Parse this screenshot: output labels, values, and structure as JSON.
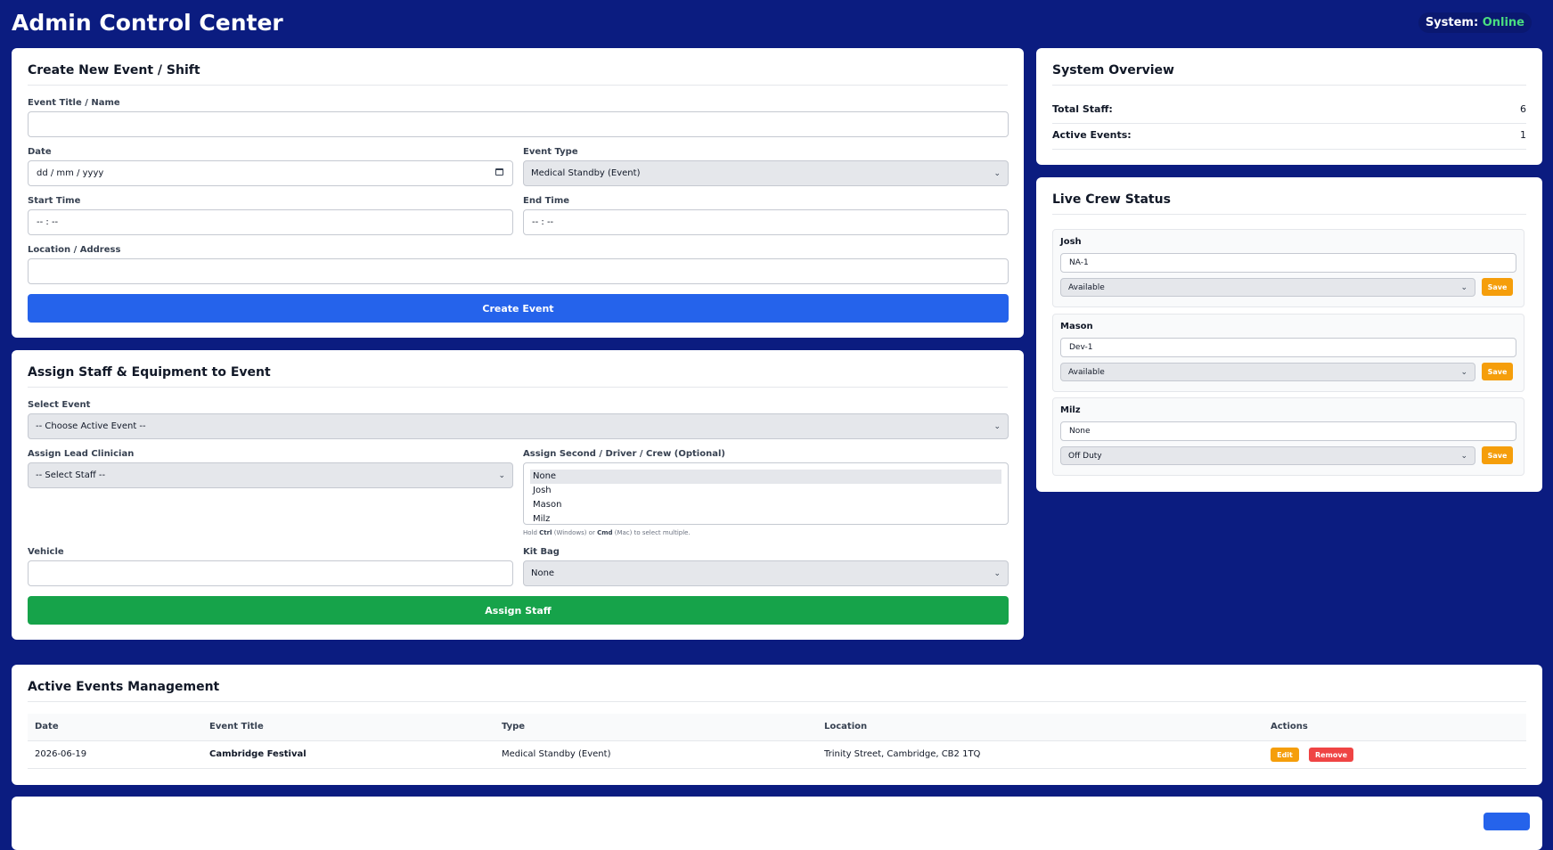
{
  "header": {
    "title": "Admin Control Center",
    "system_label": "System:",
    "system_status": "Online"
  },
  "create_event": {
    "title": "Create New Event / Shift",
    "event_title_label": "Event Title / Name",
    "date_label": "Date",
    "date_placeholder": "dd / mm / yyyy",
    "event_type_label": "Event Type",
    "event_type_value": "Medical Standby (Event)",
    "start_time_label": "Start Time",
    "start_time_placeholder": "-- : --",
    "end_time_label": "End Time",
    "end_time_placeholder": "-- : --",
    "location_label": "Location / Address",
    "submit_label": "Create Event"
  },
  "assign": {
    "title": "Assign Staff & Equipment to Event",
    "select_event_label": "Select Event",
    "select_event_value": "-- Choose Active Event --",
    "lead_label": "Assign Lead Clinician",
    "lead_value": "-- Select Staff --",
    "second_label": "Assign Second / Driver / Crew (Optional)",
    "second_options": [
      "None",
      "Josh",
      "Mason",
      "Milz"
    ],
    "hint_prefix": "Hold ",
    "hint_key1": "Ctrl",
    "hint_mid": " (Windows) or ",
    "hint_key2": "Cmd",
    "hint_suffix": " (Mac) to select multiple.",
    "vehicle_label": "Vehicle",
    "kit_label": "Kit Bag",
    "kit_value": "None",
    "submit_label": "Assign Staff"
  },
  "overview": {
    "title": "System Overview",
    "rows": [
      {
        "label": "Total Staff:",
        "value": "6"
      },
      {
        "label": "Active Events:",
        "value": "1"
      }
    ]
  },
  "crew_status": {
    "title": "Live Crew Status",
    "save_label": "Save",
    "members": [
      {
        "name": "Josh",
        "unit": "NA-1",
        "status": "Available"
      },
      {
        "name": "Mason",
        "unit": "Dev-1",
        "status": "Available"
      },
      {
        "name": "Milz",
        "unit": "None",
        "status": "Off Duty"
      }
    ]
  },
  "events_table": {
    "title": "Active Events Management",
    "columns": [
      "Date",
      "Event Title",
      "Type",
      "Location",
      "Actions"
    ],
    "rows": [
      {
        "date": "2026-06-19",
        "title": "Cambridge Festival",
        "type": "Medical Standby (Event)",
        "location": "Trinity Street, Cambridge, CB2 1TQ",
        "edit": "Edit",
        "remove": "Remove"
      }
    ]
  },
  "colors": {
    "background": "#0b1c80",
    "primary": "#2563eb",
    "success": "#16a34a",
    "warning": "#f59e0b",
    "danger": "#ef4444",
    "online": "#4ade80"
  }
}
